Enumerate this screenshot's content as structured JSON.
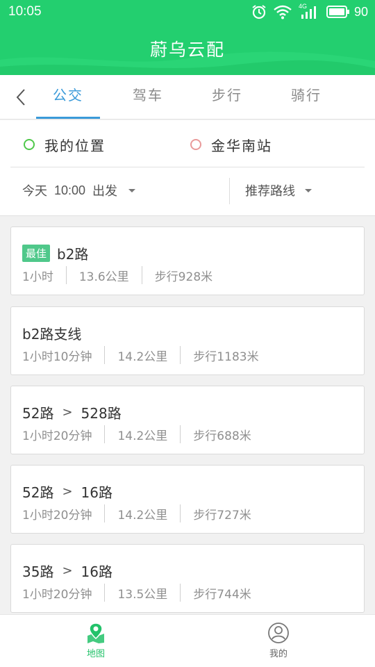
{
  "status_bar": {
    "time": "10:05",
    "signal_label": "4G",
    "battery": "90"
  },
  "app_title": "蔚乌云配",
  "tabs": [
    {
      "label": "公交",
      "active": true
    },
    {
      "label": "驾车",
      "active": false
    },
    {
      "label": "步行",
      "active": false
    },
    {
      "label": "骑行",
      "active": false
    }
  ],
  "route": {
    "from": "我的位置",
    "to": "金华南站",
    "time_select": {
      "day": "今天",
      "time": "10:00",
      "action": "出发"
    },
    "preference": "推荐路线"
  },
  "plans": [
    {
      "badge": "最佳",
      "lines": [
        "b2路"
      ],
      "duration": "1小时",
      "distance": "13.6公里",
      "walk": "步行928米"
    },
    {
      "badge": "",
      "lines": [
        "b2路支线"
      ],
      "duration": "1小时10分钟",
      "distance": "14.2公里",
      "walk": "步行1183米"
    },
    {
      "badge": "",
      "lines": [
        "52路",
        "528路"
      ],
      "duration": "1小时20分钟",
      "distance": "14.2公里",
      "walk": "步行688米"
    },
    {
      "badge": "",
      "lines": [
        "52路",
        "16路"
      ],
      "duration": "1小时20分钟",
      "distance": "14.2公里",
      "walk": "步行727米"
    },
    {
      "badge": "",
      "lines": [
        "35路",
        "16路"
      ],
      "duration": "1小时20分钟",
      "distance": "13.5公里",
      "walk": "步行744米"
    }
  ],
  "plan_arrow": ">",
  "bottom_nav": [
    {
      "label": "地图",
      "icon": "map-pin-icon",
      "active": true
    },
    {
      "label": "我的",
      "icon": "user-icon",
      "active": false
    }
  ],
  "colors": {
    "header": "#23cf6f",
    "tab_active": "#3a9ad9",
    "badge": "#4fc88a",
    "nav_active": "#23c26a"
  }
}
